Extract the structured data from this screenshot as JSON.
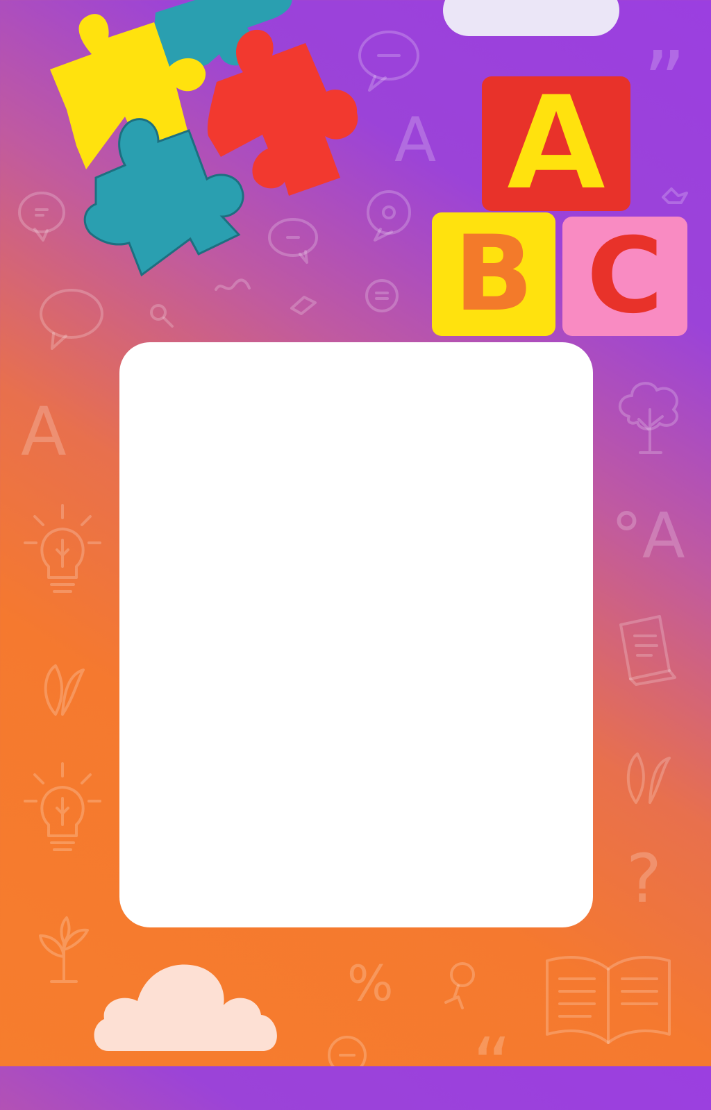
{
  "blocks": {
    "a_letter": "A",
    "b_letter": "B",
    "c_letter": "C"
  },
  "doodles": {
    "letter_a_1": "A",
    "letter_a_2": "A",
    "letter_a_3": "°A",
    "quote_mark_top": "”",
    "quote_mark_bottom": "“",
    "question_mark": "?",
    "percent_sign": "%"
  },
  "colors": {
    "gradient_top": "#9b3fe0",
    "gradient_bottom": "#f67d2d",
    "card": "#ffffff",
    "block_red": "#e8322a",
    "block_yellow": "#ffe20e",
    "block_pink": "#f98bc2",
    "puzzle_yellow": "#ffe20e",
    "puzzle_teal": "#2a9fb0",
    "puzzle_red": "#f2392f",
    "cloud_top": "#ebe6f7",
    "cloud_bottom": "#fde0d4"
  }
}
